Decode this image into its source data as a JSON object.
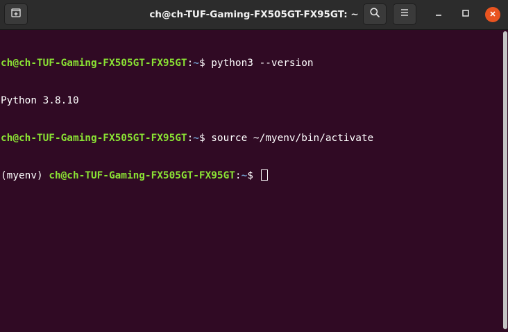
{
  "window": {
    "title": "ch@ch-TUF-Gaming-FX505GT-FX95GT: ~"
  },
  "headerbar": {
    "new_tab_icon": "new-tab-icon",
    "search_icon": "search-icon",
    "menu_icon": "hamburger-menu-icon",
    "minimize_icon": "minimize-icon",
    "maximize_icon": "maximize-icon",
    "close_icon": "close-icon"
  },
  "terminal": {
    "lines": [
      {
        "venv": "",
        "user_host": "ch@ch-TUF-Gaming-FX505GT-FX95GT",
        "colon": ":",
        "path": "~",
        "prompt": "$ ",
        "command": "python3 --version"
      },
      {
        "output": "Python 3.8.10"
      },
      {
        "venv": "",
        "user_host": "ch@ch-TUF-Gaming-FX505GT-FX95GT",
        "colon": ":",
        "path": "~",
        "prompt": "$ ",
        "command": "source ~/myenv/bin/activate"
      },
      {
        "venv": "(myenv) ",
        "user_host": "ch@ch-TUF-Gaming-FX505GT-FX95GT",
        "colon": ":",
        "path": "~",
        "prompt": "$ ",
        "command": ""
      }
    ]
  },
  "colors": {
    "background": "#300a24",
    "user_host": "#8ae234",
    "path": "#729fcf",
    "text": "#ffffff",
    "close_button": "#e95420"
  }
}
